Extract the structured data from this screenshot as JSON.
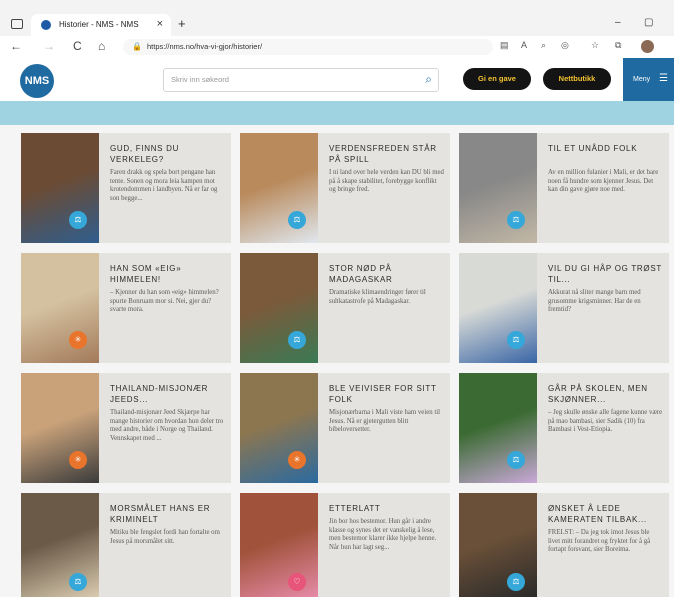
{
  "browser": {
    "tab_title": "Historier - NMS - NMS",
    "url": "https://nms.no/hva-vi-gjor/historier/",
    "new_tab": "+",
    "close": "×",
    "minimize": "–",
    "maximize": "▢",
    "nav": {
      "back": "←",
      "forward": "→",
      "reload": "C",
      "home": "⌂"
    }
  },
  "site": {
    "logo_text": "NMS",
    "search_placeholder": "Skriv inn søkeord",
    "btn_gift": "Gi en gave",
    "btn_shop": "Nettbutikk",
    "menu": "Meny",
    "colors": {
      "blue": "#1e6aa1",
      "band": "#9fd3e2",
      "yellow": "#f2c230",
      "card": "#e4e3df"
    }
  },
  "cards": [
    {
      "title": "GUD, FINNS DU VERKELEG?",
      "desc": "Faren drakk og spela bort pengane han tente. Sonen og mora leia kampen mot krotendommen i landbyen. Nå er far og son begge...",
      "badge": "scale-icon",
      "badge_color": "blue"
    },
    {
      "title": "VERDENSFREDEN STÅR PÅ SPILL",
      "desc": "I ni land over hele verden kan DU bli med på å skape stabilitet, forebygge konflikt og bringe fred.",
      "badge": "scale-icon",
      "badge_color": "blue"
    },
    {
      "title": "TIL ET UNÅDD FOLK",
      "desc": "Av en million fulanier i Mali, er det bare noen få hundre som kjenner Jesus. Det kan din gave gjøre noe med.",
      "badge": "scale-icon",
      "badge_color": "blue"
    },
    {
      "title": "HAN SOM «EIG» HIMMELEN!",
      "desc": "– Kjenner du han som «eig» himmelen? spurte Bonruam mor si. Nei, gjer du? svarte mora.",
      "badge": "cross-icon",
      "badge_color": "orange"
    },
    {
      "title": "STOR NØD PÅ MADAGASKAR",
      "desc": "Dramatiske klimaendringer fører til sultkatastrofe på Madagaskar.",
      "badge": "scale-icon",
      "badge_color": "blue"
    },
    {
      "title": "VIL DU GI HÅP OG TRØST TIL...",
      "desc": "Akkurat nå sliter mange barn med grusomme krigsminner. Har de en fremtid?",
      "badge": "scale-icon",
      "badge_color": "blue"
    },
    {
      "title": "THAILAND-MISJONÆR JEEDS...",
      "desc": "Thailand-misjonær Jeed Skjærpe har mange historier om hvordan hun deler tro med andre, både i Norge og Thailand. Vennskapet med ...",
      "badge": "cross-icon",
      "badge_color": "orange"
    },
    {
      "title": "BLE VEIVISER FOR SITT FOLK",
      "desc": "Misjonærbarna i Mali viste ham veien til Jesus. Nå er gjetergutten blitt bibeloversetter.",
      "badge": "cross-icon",
      "badge_color": "orange"
    },
    {
      "title": "GÅR PÅ SKOLEN, MEN SKJØNNER...",
      "desc": "– Jeg skulle ønske alle fagene kunne være på mao bambasi, sier Sadik (10) fra Bambasi i Vest-Etiopia.",
      "badge": "scale-icon",
      "badge_color": "blue"
    },
    {
      "title": "MORSMÅLET HANS ER KRIMINELT",
      "desc": "Mitiku ble fengslet fordi han fortalte om Jesus på morsmålet sitt.",
      "badge": "scale-icon",
      "badge_color": "blue"
    },
    {
      "title": "ETTERLATT",
      "desc": "Jin bor hos bestemor. Hun går i andre klasse og synes det er vanskelig å lese, men bestemor klarer ikke hjelpe henne. Når hun har lagt seg...",
      "badge": "heart-icon",
      "badge_color": "pink"
    },
    {
      "title": "ØNSKET Å LEDE KAMERATEN TILBAK...",
      "desc": "FRELST: – Da jeg tok imot Jesus ble livet mitt forandret og fryktet for å gå fortapt forsvant, sier Boreima.",
      "badge": "scale-icon",
      "badge_color": "blue"
    }
  ]
}
